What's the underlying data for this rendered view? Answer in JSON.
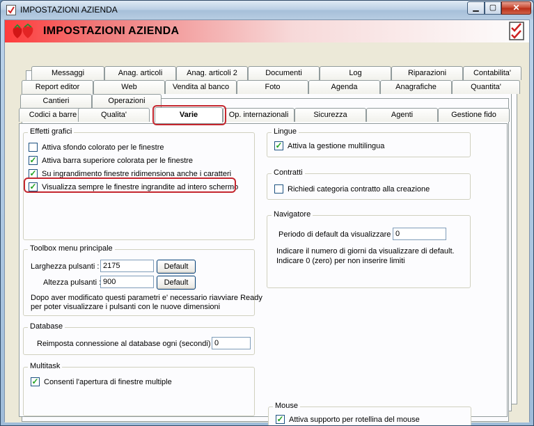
{
  "window": {
    "title": "IMPOSTAZIONI AZIENDA"
  },
  "header": {
    "title": "IMPOSTAZIONI AZIENDA"
  },
  "tabs": {
    "row1": [
      "Messaggi",
      "Anag. articoli",
      "Anag. articoli 2",
      "Documenti",
      "Log",
      "Riparazioni",
      "Contabilita'"
    ],
    "row2": [
      "Report editor",
      "Web",
      "Vendita al banco",
      "Foto",
      "Agenda",
      "Anagrafiche",
      "Quantita'"
    ],
    "row3": [
      "Cantieri",
      "Operazioni"
    ],
    "row4": [
      "Codici a barre",
      "Qualita'",
      "Varie",
      "Op. internazionali",
      "Sicurezza",
      "Agenti",
      "Gestione fido"
    ],
    "selected": "Varie"
  },
  "effetti": {
    "title": "Effetti grafici",
    "items": [
      {
        "label": "Attiva sfondo colorato per le finestre",
        "checked": false
      },
      {
        "label": "Attiva barra superiore colorata per le finestre",
        "checked": true
      },
      {
        "label": "Su ingrandimento finestre ridimensiona anche i caratteri",
        "checked": true
      },
      {
        "label": "Visualizza sempre le finestre ingrandite ad intero schermo",
        "checked": true
      }
    ]
  },
  "toolbox": {
    "title": "Toolbox menu principale",
    "width_label": "Larghezza pulsanti :",
    "width_value": "2175",
    "height_label": "Altezza pulsanti :",
    "height_value": "900",
    "default_label": "Default",
    "note1": "Dopo aver modificato questi parametri e' necessario riavviare Ready",
    "note2": "per poter visualizzare i pulsanti con le nuove dimensioni"
  },
  "database": {
    "title": "Database",
    "label": "Reimposta connessione al database ogni (secondi) :",
    "value": "0"
  },
  "multitask": {
    "title": "Multitask",
    "label": "Consenti l'apertura di finestre multiple",
    "checked": true
  },
  "lingue": {
    "title": "Lingue",
    "label": "Attiva la gestione multilingua",
    "checked": true
  },
  "contratti": {
    "title": "Contratti",
    "label": "Richiedi categoria contratto alla creazione",
    "checked": false
  },
  "navigatore": {
    "title": "Navigatore",
    "label": "Periodo di default da visualizzare :",
    "value": "0",
    "note1": "Indicare il numero di giorni da visualizzare di default.",
    "note2": "Indicare 0 (zero) per non inserire limiti"
  },
  "mouse": {
    "title": "Mouse",
    "label": "Attiva supporto per rotellina del mouse",
    "checked": true
  },
  "colors": {
    "highlight": "#c4262e",
    "checkmark": "#21a121"
  }
}
